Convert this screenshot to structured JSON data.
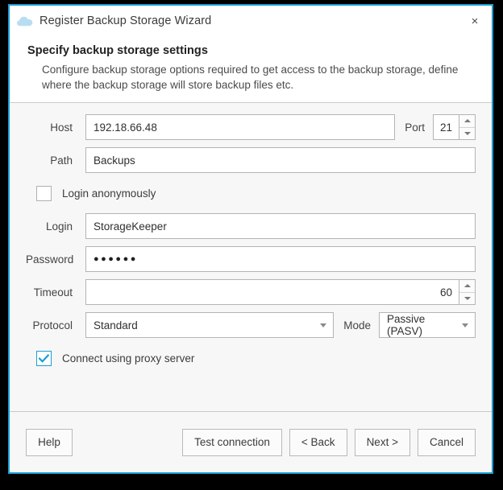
{
  "window": {
    "title": "Register Backup Storage Wizard",
    "icon": "cloud-icon",
    "close_label": "×",
    "accent_color": "#1a9ed4",
    "background_color": "#f7f7f7"
  },
  "header": {
    "title": "Specify backup storage settings",
    "description": "Configure backup storage options required to get access to the backup storage, define where the backup storage will store backup files etc."
  },
  "form": {
    "host": {
      "label": "Host",
      "value": "192.18.66.48",
      "placeholder": ""
    },
    "port": {
      "label": "Port",
      "value": "21"
    },
    "path": {
      "label": "Path",
      "value": "Backups",
      "placeholder": ""
    },
    "login_anonymously": {
      "label": "Login anonymously",
      "checked": false
    },
    "login": {
      "label": "Login",
      "value": "StorageKeeper",
      "placeholder": ""
    },
    "password": {
      "label": "Password",
      "value": "●●●●●●",
      "placeholder": ""
    },
    "timeout": {
      "label": "Timeout",
      "value": "60"
    },
    "protocol": {
      "label": "Protocol",
      "value": "Standard",
      "options": [
        "Standard"
      ]
    },
    "mode": {
      "label": "Mode",
      "value": "Passive (PASV)",
      "options": [
        "Passive (PASV)"
      ]
    },
    "use_proxy": {
      "label": "Connect using proxy server",
      "checked": true
    }
  },
  "footer": {
    "help": "Help",
    "test_connection": "Test connection",
    "back": "< Back",
    "next": "Next >",
    "cancel": "Cancel"
  }
}
